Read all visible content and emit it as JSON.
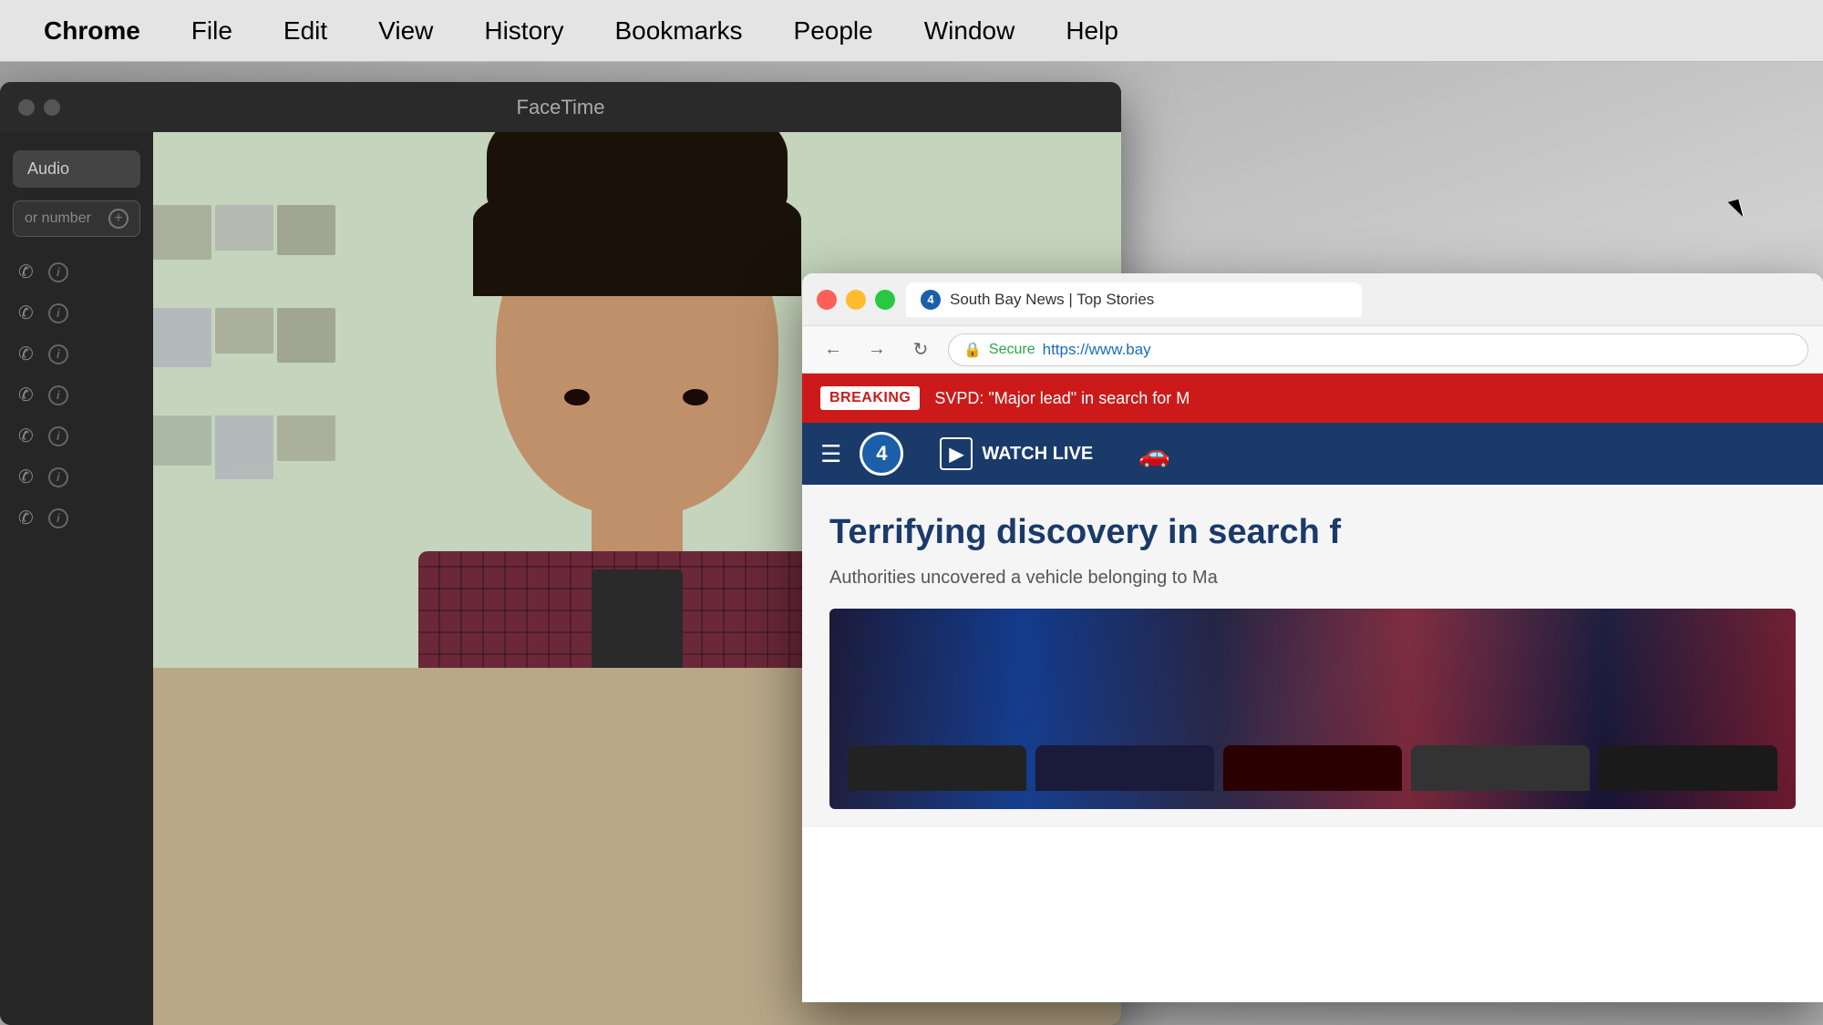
{
  "menubar": {
    "items": [
      {
        "label": "Chrome",
        "id": "chrome"
      },
      {
        "label": "File",
        "id": "file"
      },
      {
        "label": "Edit",
        "id": "edit"
      },
      {
        "label": "View",
        "id": "view"
      },
      {
        "label": "History",
        "id": "history"
      },
      {
        "label": "Bookmarks",
        "id": "bookmarks"
      },
      {
        "label": "People",
        "id": "people"
      },
      {
        "label": "Window",
        "id": "window"
      },
      {
        "label": "Help",
        "id": "help"
      }
    ]
  },
  "facetime": {
    "title": "FaceTime",
    "sidebar": {
      "audio_button": "Audio",
      "search_placeholder": "or number"
    }
  },
  "browser": {
    "tab_title": "South Bay News | Top Stories",
    "favicon_label": "4",
    "url": "https://www.bay",
    "secure_label": "Secure",
    "breaking_label": "BREAKING",
    "breaking_text": "SVPD: \"Major lead\" in search for M",
    "watch_live_label": "WATCH LIVE",
    "headline": "Terrifying discovery in search f",
    "subtext": "Authorities uncovered a vehicle belonging to Ma"
  },
  "icons": {
    "back": "←",
    "forward": "→",
    "reload": "↻",
    "lock": "🔒",
    "hamburger": "☰",
    "play": "▶",
    "phone": "📞",
    "info": "i",
    "plus": "+"
  }
}
